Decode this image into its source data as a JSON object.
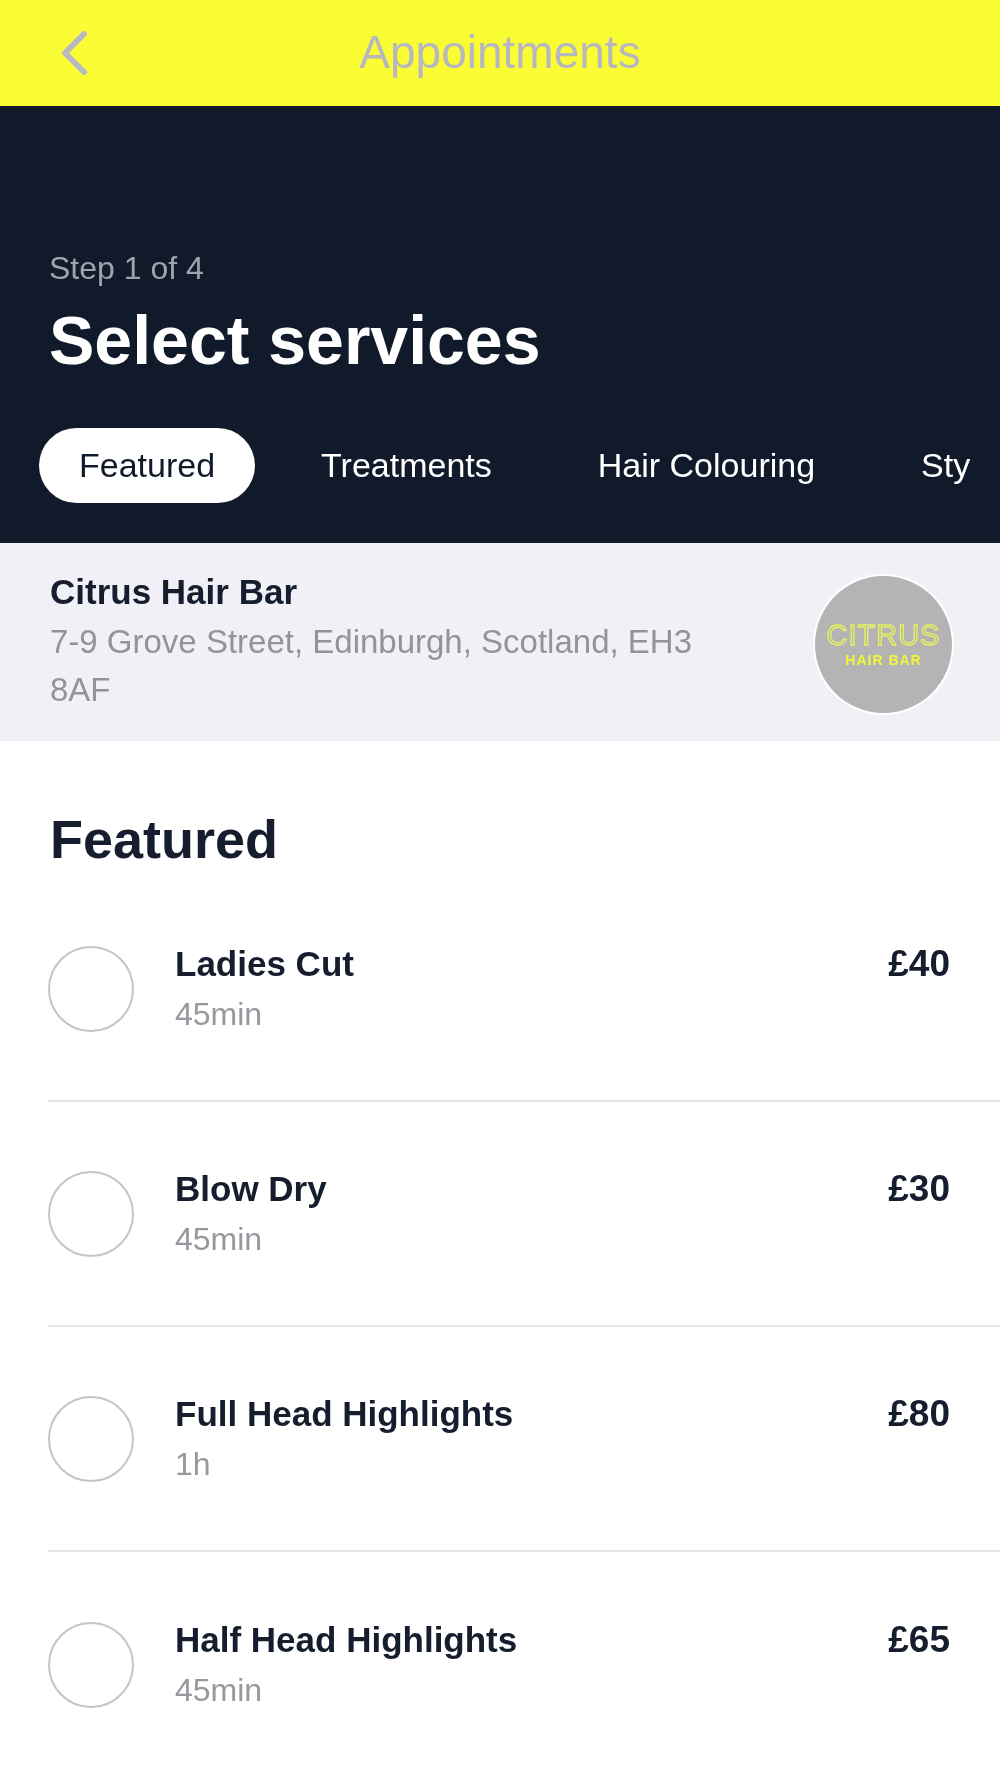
{
  "app_bar": {
    "title": "Appointments"
  },
  "header": {
    "step": "Step 1 of 4",
    "title": "Select services"
  },
  "tabs": [
    {
      "label": "Featured",
      "selected": true
    },
    {
      "label": "Treatments",
      "selected": false
    },
    {
      "label": "Hair Colouring",
      "selected": false
    },
    {
      "label": "Sty",
      "selected": false
    }
  ],
  "salon": {
    "name": "Citrus Hair Bar",
    "address": "7-9 Grove Street, Edinburgh, Scotland, EH3 8AF",
    "logo": {
      "wordmark": "CITRUS",
      "tagline": "HAIR BAR"
    }
  },
  "section": {
    "title": "Featured",
    "services": [
      {
        "name": "Ladies Cut",
        "duration": "45min",
        "price": "£40",
        "selected": false
      },
      {
        "name": "Blow Dry",
        "duration": "45min",
        "price": "£30",
        "selected": false
      },
      {
        "name": "Full Head Highlights",
        "duration": "1h",
        "price": "£80",
        "selected": false
      },
      {
        "name": "Half Head Highlights",
        "duration": "45min",
        "price": "£65",
        "selected": false
      }
    ]
  }
}
